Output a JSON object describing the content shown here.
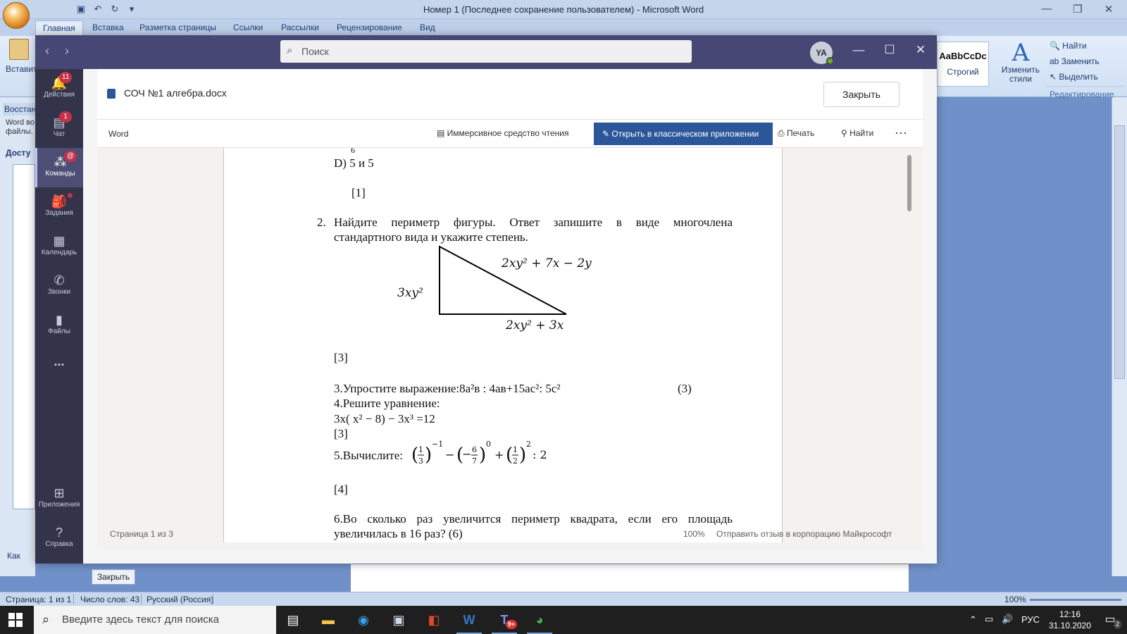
{
  "word": {
    "title": "Номер 1 (Последнее сохранение пользователем) - Microsoft Word",
    "tabs": [
      "Главная",
      "Вставка",
      "Разметка страницы",
      "Ссылки",
      "Рассылки",
      "Рецензирование",
      "Вид"
    ],
    "paste_label": "Вставить",
    "styles_sample": "AaBbCcDc",
    "style_name": "Строгий",
    "change_styles": "Изменить стили",
    "find": "Найти",
    "replace": "Заменить",
    "select": "Выделить",
    "editing_group": "Редактирование",
    "panel_title": "Восстан",
    "panel_text_1": "Word во",
    "panel_text_2": "файлы.",
    "panel_heading": "Досту",
    "panel_link": "Как",
    "close_button": "Закрыть",
    "status": {
      "page": "Страница: 1 из 1",
      "words": "Число слов: 43",
      "language": "Русский (Россия)",
      "zoom": "100%"
    }
  },
  "teams": {
    "search_placeholder": "Поиск",
    "avatar_initials": "YA",
    "rail": [
      {
        "label": "Действия",
        "badge": "11",
        "icon": "bell-icon"
      },
      {
        "label": "Чат",
        "badge": "1",
        "icon": "chat-icon"
      },
      {
        "label": "Команды",
        "badge": "@",
        "icon": "teams-icon"
      },
      {
        "label": "Задания",
        "icon": "assignments-icon"
      },
      {
        "label": "Календарь",
        "icon": "calendar-icon"
      },
      {
        "label": "Звонки",
        "icon": "phone-icon"
      },
      {
        "label": "Файлы",
        "icon": "files-icon"
      },
      {
        "label": "Приложения",
        "icon": "apps-icon"
      },
      {
        "label": "Справка",
        "icon": "help-icon"
      }
    ],
    "more_label": "...",
    "file_name": "СОЧ №1 алгебра.docx",
    "close_label": "Закрыть",
    "viewer": {
      "app_name": "Word",
      "immersive": "Иммерсивное средство чтения",
      "open_desktop": "Открыть в классическом приложении",
      "print": "Печать",
      "find": "Найти",
      "page_info": "Страница 1 из 3",
      "zoom": "100%",
      "feedback": "Отправить отзыв в корпорацию Майкрософт"
    },
    "document": {
      "frag_top": "6",
      "option_d": "D) 5 и 5",
      "mark1": "[1]",
      "q2_num": "2.",
      "q2_line1": "Найдите периметр фигуры. Ответ запишите в виде многочлена",
      "q2_line2": "стандартного вида и укажите степень.",
      "tri_side_left": "3xy²",
      "tri_hyp": "2xy² + 7x − 2y",
      "tri_bottom": "2xy² + 3x",
      "mark3a": "[3]",
      "q3": "3.Упростите выражение:8а²в : 4ав+15ас²: 5с²",
      "q3_mark": "(3)",
      "q4": "4.Решите уравнение:",
      "q4_eq": "3х( х² − 8) − 3х³  =12",
      "mark3b": "[3]",
      "q5_label": "5.Вычислите:",
      "mark4": "[4]",
      "q6_line1": "6.Во сколько раз увеличится периметр квадрата, если его площадь",
      "q6_line2": "увеличилась в 16 раз?    (6)"
    }
  },
  "taskbar": {
    "search_placeholder": "Введите здесь текст для поиска",
    "teams_badge": "9+",
    "language": "РУС",
    "time": "12:16",
    "date": "31.10.2020",
    "notifications": "2"
  }
}
